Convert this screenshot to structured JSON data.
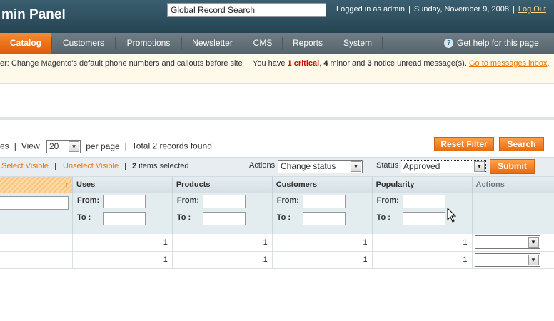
{
  "header": {
    "title": "min Panel",
    "search_value": "Global Record Search",
    "logged_in": "Logged in as admin",
    "date": "Sunday, November 9, 2008",
    "logout": "Log Out"
  },
  "nav": {
    "items": [
      {
        "label": "Catalog",
        "active": true
      },
      {
        "label": "Customers"
      },
      {
        "label": "Promotions"
      },
      {
        "label": "Newsletter"
      },
      {
        "label": "CMS"
      },
      {
        "label": "Reports"
      },
      {
        "label": "System"
      }
    ],
    "help": "Get help for this page"
  },
  "messages": {
    "left": "er: Change Magento's default phone numbers and callouts before site",
    "prefix": "You have",
    "critical": "1 critical",
    "minor_count": "4",
    "minor_text": "minor and",
    "notice_count": "3",
    "notice_text": "notice unread message(s).",
    "link": "Go to messages inbox",
    "suffix": "."
  },
  "pager": {
    "pages_tail": "es",
    "view_label": "View",
    "per_page": "20",
    "per_page_label": "per page",
    "total": "Total 2 records found"
  },
  "buttons": {
    "reset_filter": "Reset Filter",
    "search": "Search",
    "submit": "Submit"
  },
  "massaction": {
    "select_visible": "Select Visible",
    "unselect_visible": "Unselect Visible",
    "selected_count": "2",
    "selected_text": "items selected",
    "actions_label": "Actions",
    "actions_value": "Change status",
    "status_label": "Status",
    "status_value": "Approved"
  },
  "grid": {
    "sort_arrow": "↑",
    "columns": [
      "Uses",
      "Products",
      "Customers",
      "Popularity",
      "Actions"
    ],
    "from_label": "From:",
    "to_label": "To :",
    "rows": [
      [
        "1",
        "1",
        "1",
        "1"
      ],
      [
        "1",
        "1",
        "1",
        "1"
      ]
    ]
  },
  "colors": {
    "accent": "#ea7601",
    "header_bg": "#2b4a5a",
    "critical": "#d40707"
  }
}
